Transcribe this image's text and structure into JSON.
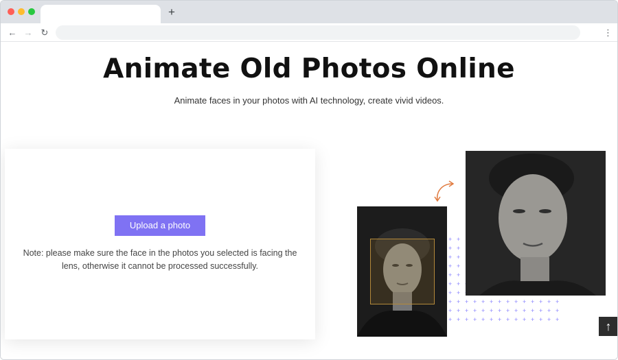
{
  "browser": {
    "new_tab_icon": "plus-icon",
    "back_icon": "arrow-left-icon",
    "forward_icon": "arrow-right-icon",
    "reload_icon": "reload-icon",
    "menu_icon": "kebab-menu-icon"
  },
  "hero": {
    "title": "Animate Old Photos Online",
    "subtitle": "Animate faces in your photos with AI technology, create vivid videos."
  },
  "upload": {
    "button_label": "Upload a photo",
    "note": "Note: please make sure the face in the photos you selected is facing the lens, otherwise it cannot be processed successfully."
  },
  "colors": {
    "accent": "#7f72f3",
    "face_box": "#b58a3a",
    "plus_pattern": "#8b86ff",
    "arrow": "#e07a3f"
  }
}
